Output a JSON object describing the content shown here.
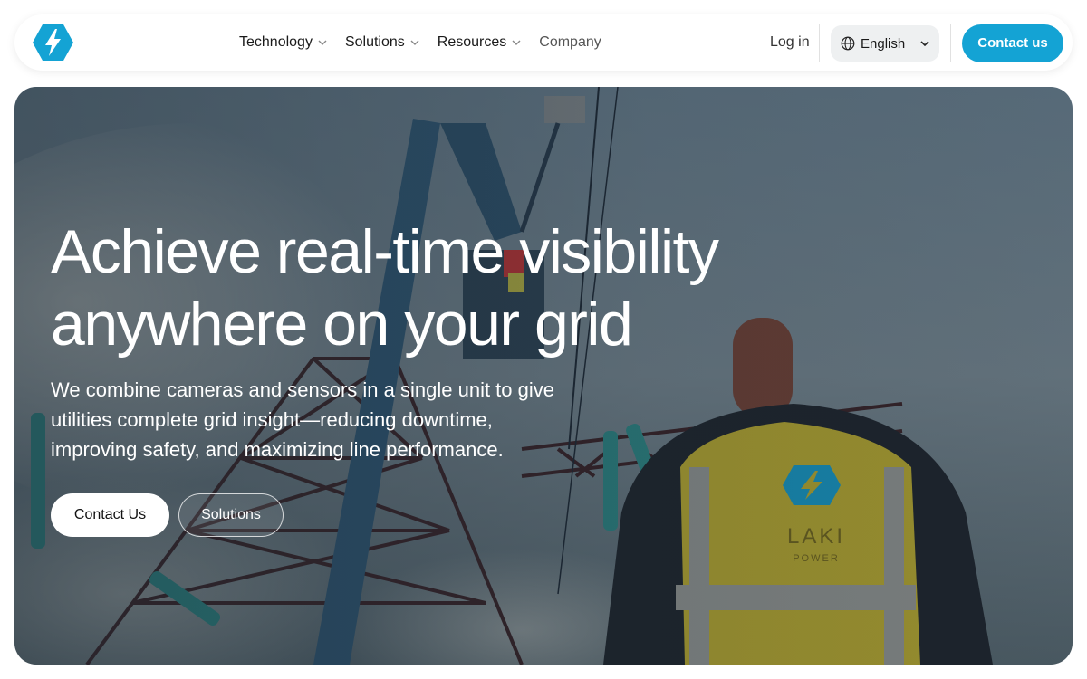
{
  "brand": {
    "logo_icon": "lightning-hexagon-icon",
    "accent": "#14a3d4"
  },
  "nav": {
    "items": [
      {
        "label": "Technology",
        "has_dropdown": true
      },
      {
        "label": "Solutions",
        "has_dropdown": true
      },
      {
        "label": "Resources",
        "has_dropdown": true
      },
      {
        "label": "Company",
        "has_dropdown": false
      }
    ],
    "login_label": "Log in",
    "language": {
      "selected": "English",
      "icon": "globe-icon"
    },
    "contact_label": "Contact us"
  },
  "hero": {
    "title_line1": "Achieve real-time visibility",
    "title_line2": "anywhere on your grid",
    "text": "We combine cameras and sensors in a single unit to give utilities complete grid insight—reducing downtime, improving safety, and maximizing line performance.",
    "primary_button": "Contact Us",
    "secondary_button": "Solutions",
    "vest_logo_text": "LAKI",
    "vest_logo_subtext": "POWER"
  }
}
